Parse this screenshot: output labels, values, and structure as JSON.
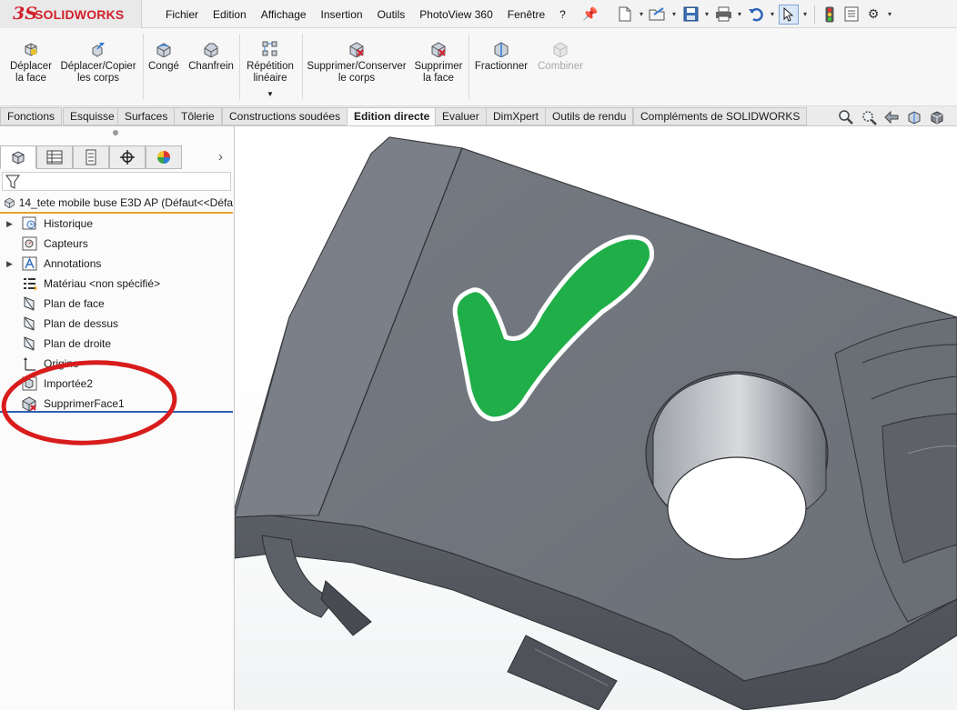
{
  "app": {
    "brand_mark": "3S",
    "brand_name": "SOLIDWORKS"
  },
  "menu": [
    "Fichier",
    "Edition",
    "Affichage",
    "Insertion",
    "Outils",
    "PhotoView 360",
    "Fenêtre",
    "?"
  ],
  "quick_access": [
    "new-document-icon",
    "open-icon",
    "save-icon",
    "print-icon",
    "undo-icon",
    "select-icon",
    "rebuild-icon",
    "file-properties-icon",
    "options-icon"
  ],
  "ribbon": {
    "move_face": [
      "Déplacer",
      "la face"
    ],
    "move_copy_bodies": [
      "Déplacer/Copier",
      "les corps"
    ],
    "fillet": "Congé",
    "chamfer": "Chanfrein",
    "linear_pattern": [
      "Répétition",
      "linéaire"
    ],
    "delete_keep_body": [
      "Supprimer/Conserver",
      "le corps"
    ],
    "delete_face": [
      "Supprimer",
      "la face"
    ],
    "split": "Fractionner",
    "combine": "Combiner"
  },
  "tabs": [
    "Fonctions",
    "Esquisse",
    "Surfaces",
    "Tôlerie",
    "Constructions soudées",
    "Edition directe",
    "Evaluer",
    "DimXpert",
    "Outils de rendu",
    "Compléments de SOLIDWORKS"
  ],
  "active_tab": "Edition directe",
  "feature_tree": {
    "part_label": "14_tete mobile buse E3D AP  (Défaut<<Défa",
    "items": [
      {
        "label": "Historique"
      },
      {
        "label": "Capteurs"
      },
      {
        "label": "Annotations"
      },
      {
        "label": "Matériau <non spécifié>"
      },
      {
        "label": "Plan de face"
      },
      {
        "label": "Plan de dessus"
      },
      {
        "label": "Plan de droite"
      },
      {
        "label": "Origine"
      },
      {
        "label": "Importée2"
      },
      {
        "label": "SupprimerFace1"
      }
    ]
  },
  "colors": {
    "brand_red": "#d21f2b",
    "accent_orange": "#e8a12a",
    "rollback_blue": "#2c5fb3",
    "highlight_ring": "#d81c1c",
    "checkmark_green": "#1fae48",
    "model_gray": "#6f737a"
  }
}
